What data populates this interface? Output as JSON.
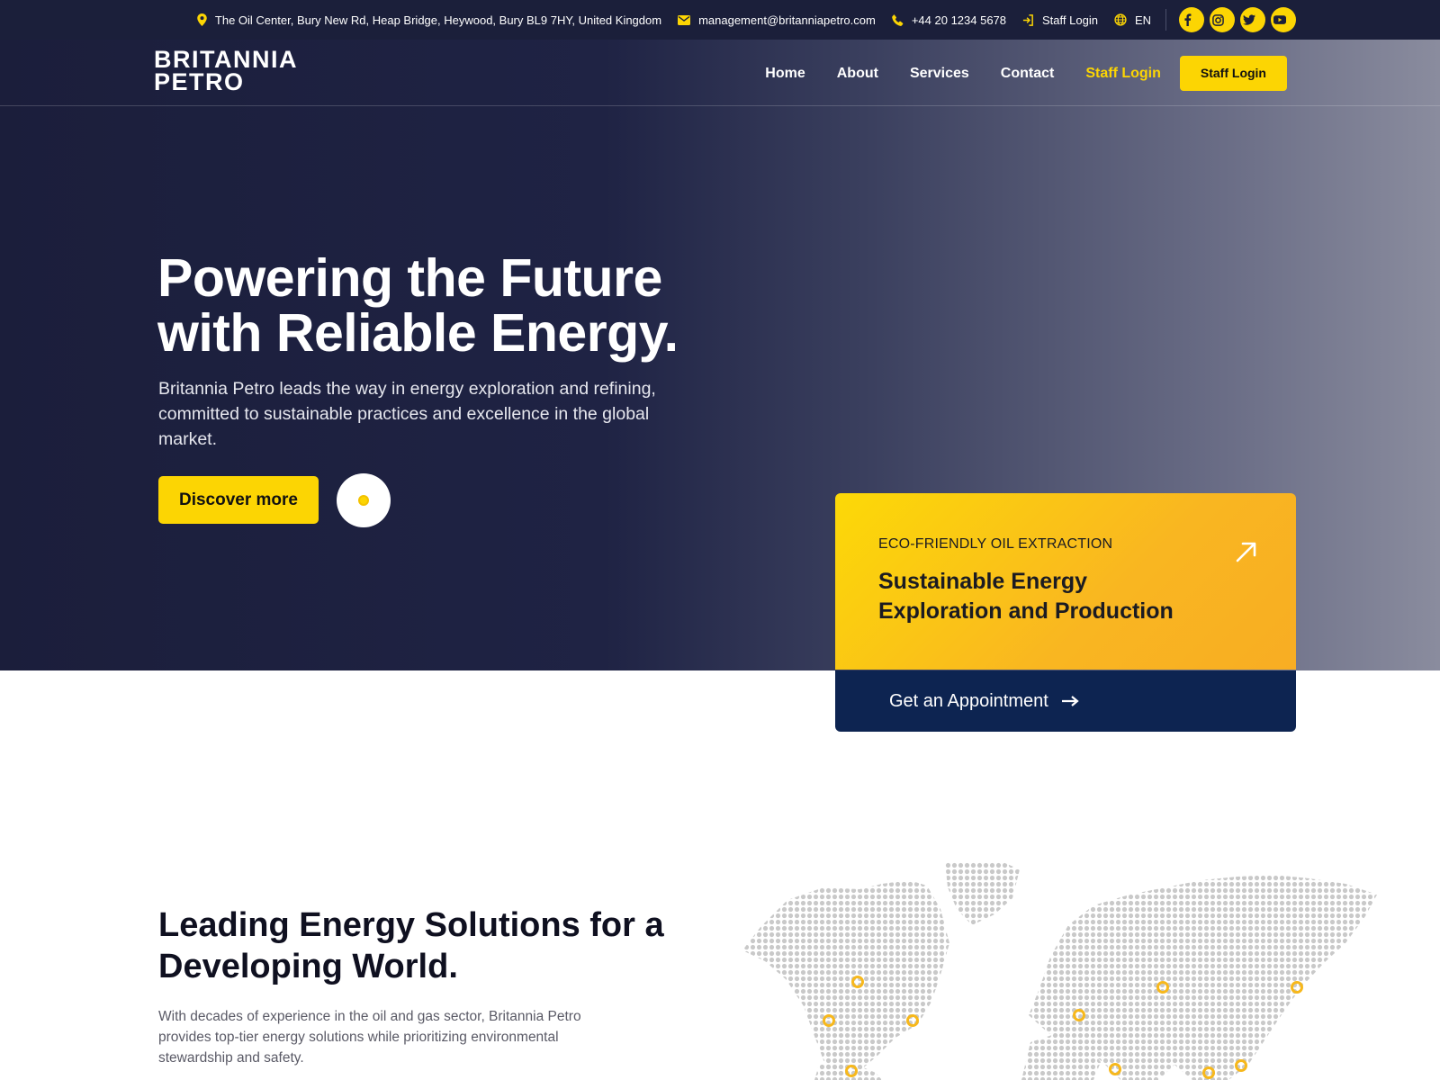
{
  "topbar": {
    "address": "The Oil Center, Bury New Rd, Heap Bridge, Heywood, Bury BL9 7HY, United Kingdom",
    "email": "management@britanniapetro.com",
    "phone": "+44 20 1234 5678",
    "staff_login": "Staff Login",
    "language": "EN",
    "socials": [
      "facebook-icon",
      "instagram-icon",
      "twitter-icon",
      "youtube-icon"
    ]
  },
  "logo": {
    "line1": "BRITANNIA",
    "line2": "PETRO"
  },
  "nav": {
    "items": [
      "Home",
      "About",
      "Services",
      "Contact"
    ],
    "highlight": "Staff Login",
    "button": "Staff Login"
  },
  "hero": {
    "title_line1": "Powering the Future",
    "title_line2": "with Reliable Energy.",
    "description": "Britannia Petro leads the way in energy exploration and refining, committed to sustainable practices and excellence in the global market.",
    "cta": "Discover more"
  },
  "card": {
    "kicker": "ECO-FRIENDLY OIL EXTRACTION",
    "title": "Sustainable Energy Exploration and Production",
    "appointment": "Get an Appointment"
  },
  "section": {
    "title": "Leading Energy Solutions for a Developing World.",
    "description": "With decades of experience in the oil and gas sector, Britannia Petro provides top-tier energy solutions while prioritizing environmental stewardship and safety."
  },
  "colors": {
    "accent": "#fcd503",
    "navy": "#1b1f3a",
    "appointment_bg": "#0d2451",
    "map_dot": "#c9c9c9",
    "map_marker": "#f7b81c"
  }
}
